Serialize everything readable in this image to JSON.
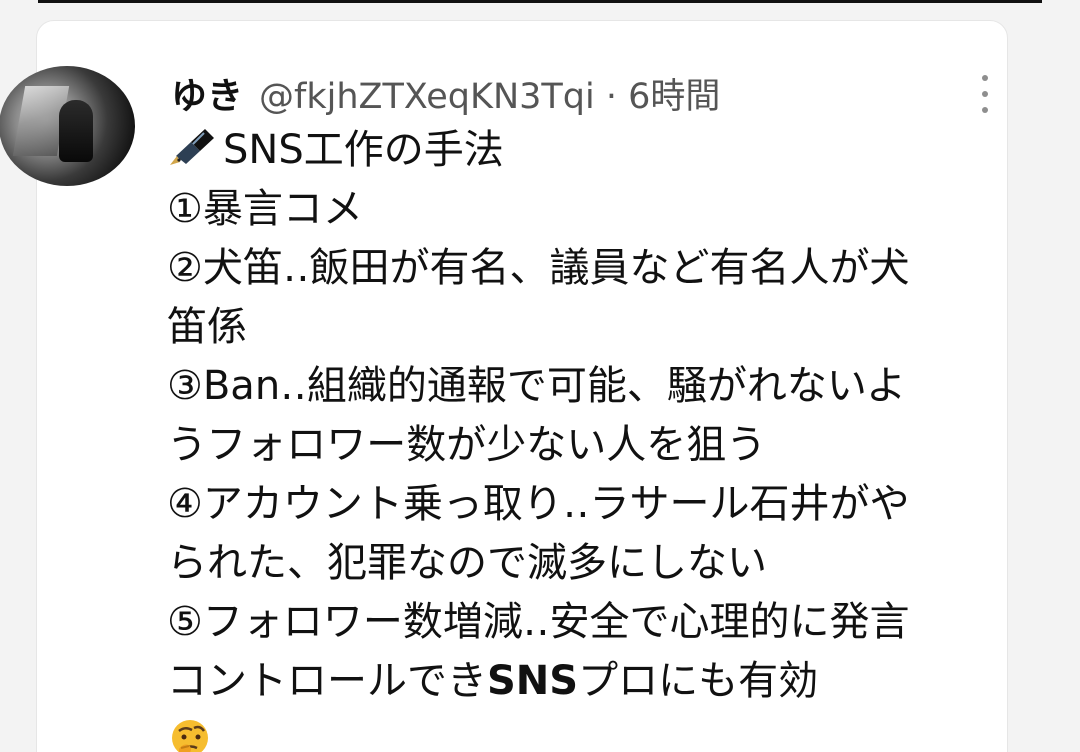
{
  "tweet": {
    "author_name": "ゆき",
    "author_handle_time": "@fkjhZTXeqKN3Tqi · 6時間",
    "title_emoji": "pen-icon",
    "title": "SNS工作の手法",
    "lines": [
      "①暴言コメ",
      "②犬笛‥飯田が有名、議員など有名人が犬",
      "笛係",
      "③Ban‥組織的通報で可能、騒がれないよ",
      "うフォロワー数が少ない人を狙う",
      "④アカウント乗っ取り‥ラサール石井がや",
      "られた、犯罪なので滅多にしない",
      "⑤フォロワー数増減‥安全で心理的に発言",
      "コントロールでき"
    ],
    "line9_bold": "SNS",
    "line9_rest": "プロにも有効",
    "end_emoji": "thinking-face-icon"
  }
}
